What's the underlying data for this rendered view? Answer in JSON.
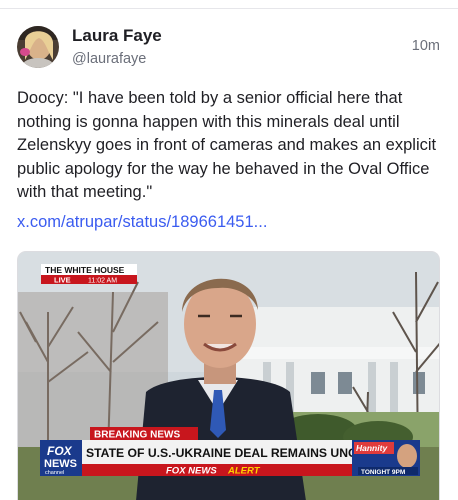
{
  "post": {
    "author_name": "Laura Faye",
    "author_handle": "@laurafaye",
    "timestamp": "10m",
    "text": "Doocy: \"I have been told by a senior official here that nothing is gonna happen with this minerals deal until Zelenskyy goes in front of cameras and makes an explicit public apology for the way he behaved in the Oval Office with that meeting.\"",
    "link": "x.com/atrupar/status/189661451..."
  },
  "media": {
    "location_label": "THE WHITE HOUSE",
    "live_label": "LIVE",
    "time_label": "11:02 AM",
    "breaking_label": "BREAKING NEWS",
    "headline": "STATE OF U.S.-UKRAINE DEAL REMAINS UNCERTAIN",
    "alert_brand": "FOX NEWS",
    "alert_word": "ALERT",
    "network_top": "FOX",
    "network_bottom": "NEWS",
    "network_sub": "channel",
    "promo_show": "Hannity",
    "promo_time": "TONIGHT 9PM"
  },
  "colors": {
    "link": "#3b5cf0",
    "breaking_red": "#c8161d",
    "fox_blue": "#1a3a8c",
    "alert_yellow": "#ffd200"
  }
}
